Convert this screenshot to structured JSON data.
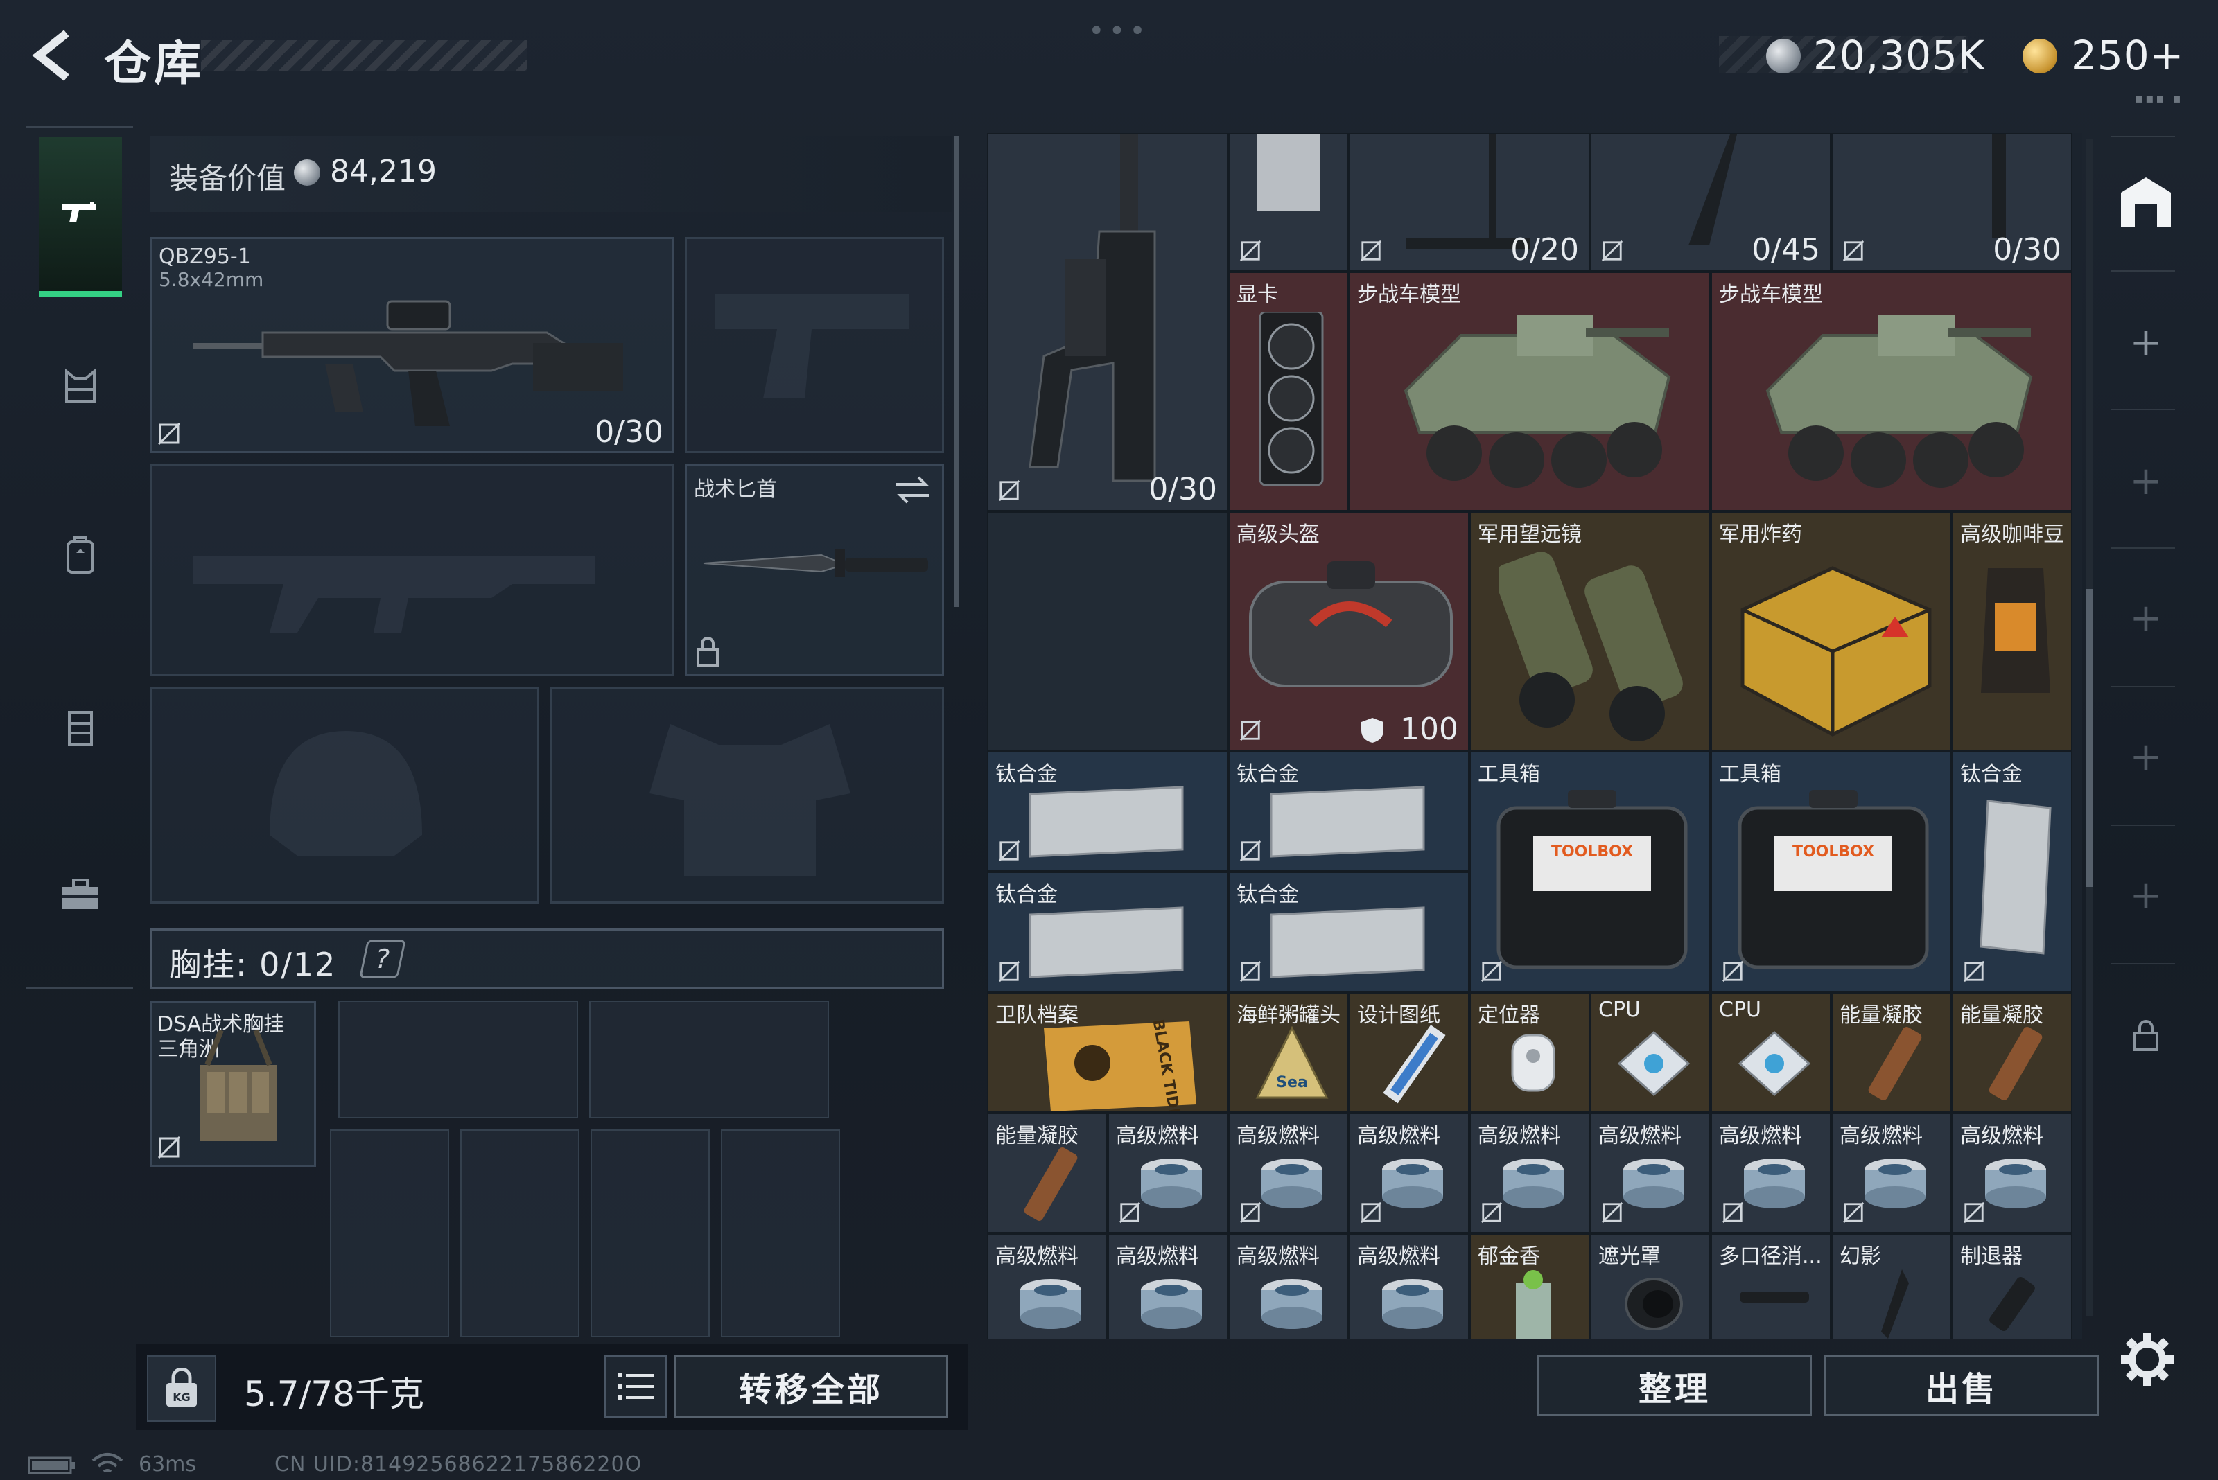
{
  "header": {
    "title": "仓库",
    "currency_silver": "20,305K",
    "currency_gold": "250+"
  },
  "nav": {
    "items": [
      "gun-icon",
      "armor-icon",
      "backpack-icon",
      "vest-icon",
      "toolbox-icon"
    ]
  },
  "equipment": {
    "value_label": "装备价值",
    "value": "84,219",
    "primary_weapon": {
      "name": "QBZ95-1",
      "caliber": "5.8x42mm",
      "ammo": "0/30"
    },
    "knife": {
      "name": "战术匕首"
    },
    "chest_rig_label": "胸挂: 0/12",
    "chest_help": "?",
    "chest_rig_item": "DSA战术胸挂",
    "chest_rig_item_sub": "三角洲"
  },
  "footer_left": {
    "weight": "5.7/78千克",
    "transfer_all": "转移全部"
  },
  "footer_right": {
    "sort": "整理",
    "sell": "出售"
  },
  "storage": {
    "top_row_counts": [
      "0/20",
      "0/45",
      "0/30"
    ],
    "rifle_ammo": "0/30",
    "items": {
      "gpu": "显卡",
      "ifv1": "步战车模型",
      "ifv2": "步战车模型",
      "helmet": "高级头盔",
      "helmet_durability": "100",
      "binoculars": "军用望远镜",
      "explosives": "军用炸药",
      "coffee": "高级咖啡豆",
      "ti1": "钛合金",
      "ti2": "钛合金",
      "ti3": "钛合金",
      "ti4": "钛合金",
      "ti5": "钛合金",
      "toolbox1": "工具箱",
      "toolbox2": "工具箱",
      "dossier": "卫队档案",
      "seafood": "海鲜粥罐头",
      "blueprint": "设计图纸",
      "locator": "定位器",
      "cpu1": "CPU",
      "cpu2": "CPU",
      "gel1": "能量凝胶",
      "gel2": "能量凝胶",
      "gel3": "能量凝胶",
      "fuel": "高级燃料",
      "tulip": "郁金香",
      "hood": "遮光罩",
      "suppressor": "多口径消...",
      "phantom": "幻影",
      "brake": "制退器"
    },
    "dossier_art_text": "BLACK TIDE",
    "seafood_art_text": "Sea",
    "toolbox_art_text": "TOOLBOX"
  },
  "status": {
    "ping": "63ms",
    "uid": "CN UID:8149256862217586220O"
  }
}
